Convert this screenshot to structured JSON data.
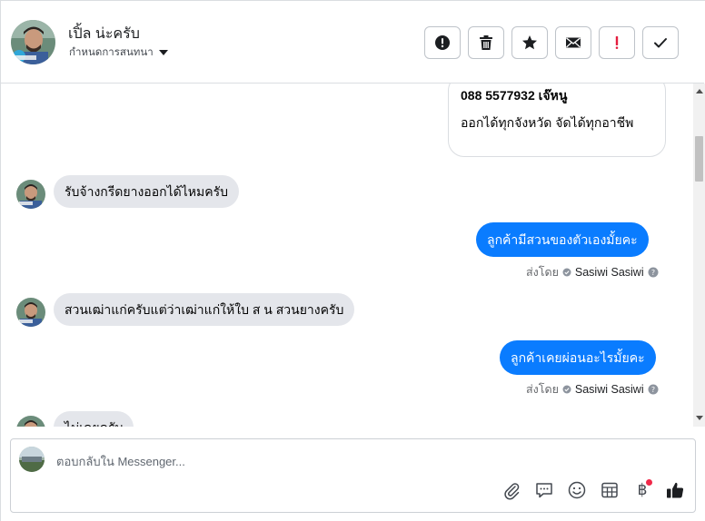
{
  "header": {
    "name": "เปิ้ล น่ะครับ",
    "assign_label": "กำหนดการสนทนา",
    "actions": [
      {
        "icon": "alert-circle-icon",
        "name": "spam-button"
      },
      {
        "icon": "trash-icon",
        "name": "delete-button"
      },
      {
        "icon": "star-icon",
        "name": "star-button"
      },
      {
        "icon": "envelope-icon",
        "name": "mark-unread-button"
      },
      {
        "icon": "exclamation-icon",
        "name": "follow-up-button"
      },
      {
        "icon": "check-icon",
        "name": "done-button"
      }
    ],
    "accent_red": "#e41e3f"
  },
  "messages": {
    "card": {
      "phone": "088 5577932 เจ๊หนู",
      "text": "ออกได้ทุกจังหวัด จัดได้ทุกอาชีพ"
    },
    "incoming": [
      "รับจ้างกรีดยางออกได้ไหมครับ",
      "สวนเฒ่าแก่ครับแต่ว่าเฒ่าแก่ให้ใบ  ส น  สวนยางครับ",
      "ไม่เคยครับ"
    ],
    "outgoing": [
      {
        "text": "ลูกค้ามีสวนของตัวเองมั้ยคะ",
        "sent_by_label": "ส่งโดย",
        "sender": "Sasiwi Sasiwi"
      },
      {
        "text": "ลูกค้าเคยผ่อนอะไรมั้ยคะ",
        "sent_by_label": "ส่งโดย",
        "sender": "Sasiwi Sasiwi"
      }
    ],
    "outgoing_color": "#0a7cff",
    "incoming_color": "#e4e6eb"
  },
  "composer": {
    "placeholder": "ตอบกลับใน Messenger...",
    "tools": [
      "paperclip-icon",
      "speech-bubble-icon",
      "emoji-icon",
      "table-icon",
      "baht-icon",
      "thumbs-up-icon"
    ],
    "baht_symbol": "฿"
  }
}
